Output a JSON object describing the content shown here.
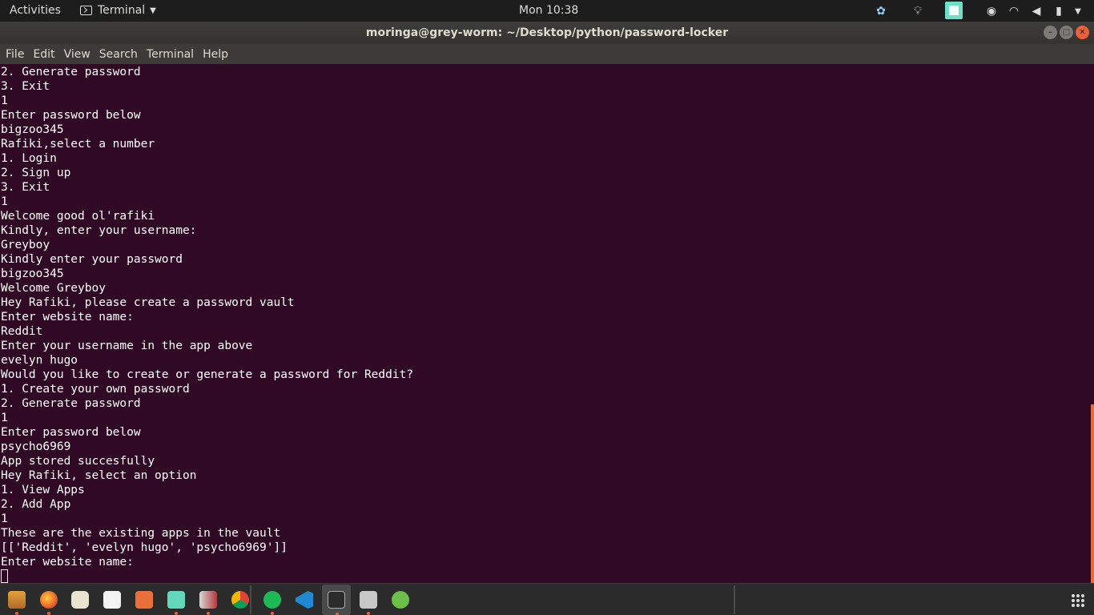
{
  "topbar": {
    "activities": "Activities",
    "app_name": "Terminal",
    "clock": "Mon 10:38"
  },
  "window": {
    "title": "moringa@grey-worm: ~/Desktop/python/password-locker"
  },
  "menu": [
    "File",
    "Edit",
    "View",
    "Search",
    "Terminal",
    "Help"
  ],
  "terminal_lines": [
    "2. Generate password",
    "3. Exit",
    "1",
    "Enter password below",
    "bigzoo345",
    "Rafiki,select a number",
    "1. Login",
    "2. Sign up",
    "3. Exit",
    "1",
    "Welcome good ol'rafiki",
    "Kindly, enter your username:",
    "Greyboy",
    "Kindly enter your password",
    "bigzoo345",
    "Welcome Greyboy",
    "Hey Rafiki, please create a password vault",
    "Enter website name:",
    "Reddit",
    "Enter your username in the app above",
    "evelyn hugo",
    "Would you like to create or generate a password for Reddit?",
    "1. Create your own password",
    "2. Generate password",
    "1",
    "Enter password below",
    "psycho6969",
    "App stored succesfully",
    "Hey Rafiki, select an option",
    "1. View Apps",
    "2. Add App",
    "1",
    "These are the existing apps in the vault",
    "[['Reddit', 'evelyn hugo', 'psycho6969']]",
    "Enter website name:"
  ],
  "colors": {
    "terminal_bg": "#300a24",
    "accent": "#e9603a"
  },
  "dock_icons": [
    "files-icon",
    "firefox-icon",
    "libreoffice-icon",
    "writer-icon",
    "software-center-icon",
    "screenshot-icon",
    "impress-icon",
    "chrome-icon",
    "spotify-icon",
    "vscode-icon",
    "terminal-icon",
    "installer-icon",
    "chat-icon"
  ]
}
